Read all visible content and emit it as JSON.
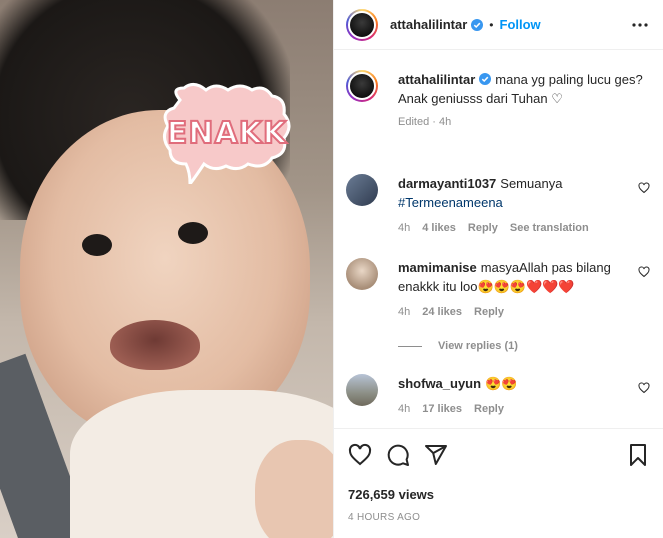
{
  "post": {
    "sticker_text": "ENAKK"
  },
  "header": {
    "username": "attahalilintar",
    "separator": "•",
    "follow_label": "Follow"
  },
  "caption": {
    "username": "attahalilintar",
    "text_line1": "mana yg paling lucu ges?",
    "text_line2": "Anak geniusss dari Tuhan ♡",
    "meta": "Edited · 4h"
  },
  "comments": [
    {
      "username": "darmayanti1037",
      "text": "Semuanya",
      "tag": "#Termeenameena",
      "time": "4h",
      "likes": "4 likes",
      "reply_label": "Reply",
      "translate_label": "See translation"
    },
    {
      "username": "mamimanise",
      "text": "masyaAllah pas bilang enakkk itu loo😍😍😍❤️❤️❤️",
      "time": "4h",
      "likes": "24 likes",
      "reply_label": "Reply",
      "view_replies": "View replies (1)"
    },
    {
      "username": "shofwa_uyun",
      "text": "😍😍",
      "time": "4h",
      "likes": "17 likes",
      "reply_label": "Reply"
    }
  ],
  "footer": {
    "views": "726,659 views",
    "time_ago": "4 HOURS AGO"
  },
  "colors": {
    "accent": "#0095f6",
    "text": "#262626",
    "muted": "#8e8e8e"
  }
}
